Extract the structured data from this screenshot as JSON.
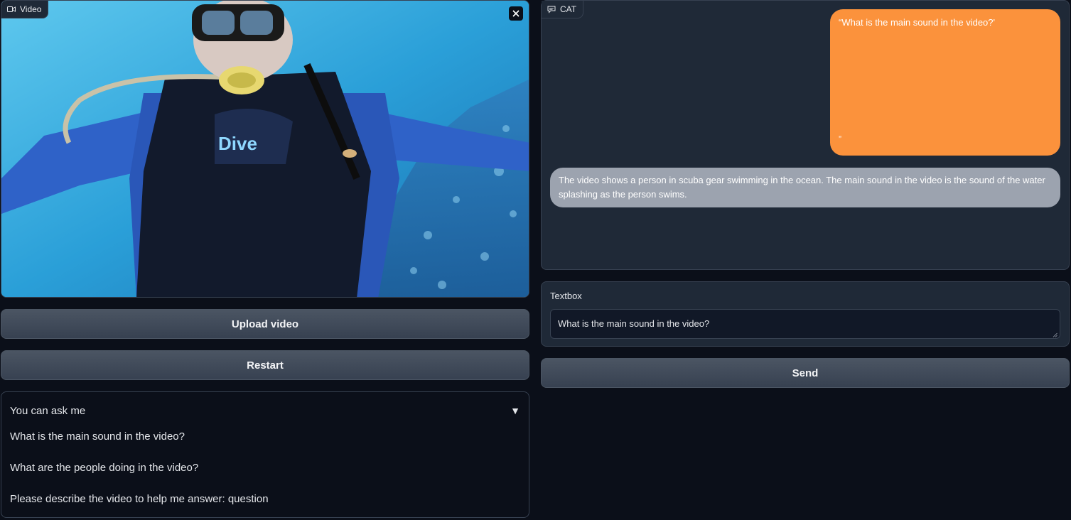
{
  "video": {
    "label": "Video",
    "icon": "video-camera-icon",
    "close_icon": "close-icon",
    "upload_label": "Upload video",
    "restart_label": "Restart"
  },
  "examples": {
    "title": "You can ask me",
    "toggle_icon": "triangle-down-icon",
    "items": [
      "What is the main sound in the video?",
      "What are the people doing in the video?",
      "Please describe the video to help me answer: question"
    ]
  },
  "chat": {
    "label": "CAT",
    "icon": "chat-bubble-icon",
    "messages": [
      {
        "role": "user",
        "text": "“What is the main sound in the video?'",
        "tail": "”"
      },
      {
        "role": "bot",
        "text": "The video shows a person in scuba gear swimming in the ocean. The main sound in the video is the sound of the water splashing as the person swims."
      }
    ]
  },
  "textbox": {
    "label": "Textbox",
    "value": "What is the main sound in the video?",
    "send_label": "Send"
  },
  "colors": {
    "background": "#0b0f19",
    "panel": "#1f2937",
    "border": "#374151",
    "user_bubble": "#fb923c",
    "bot_bubble": "#9ca3af"
  }
}
